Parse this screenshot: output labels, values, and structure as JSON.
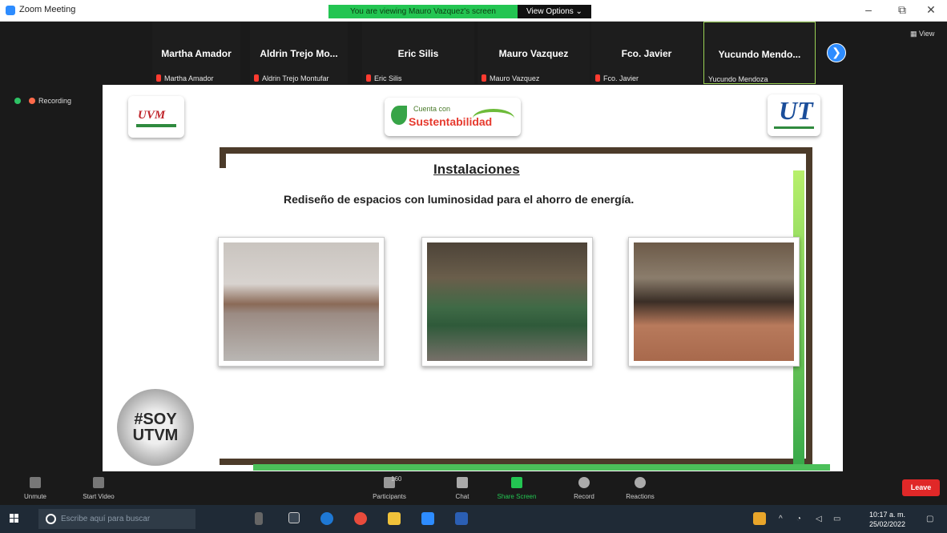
{
  "window": {
    "title": "Zoom Meeting",
    "share_banner": "You are viewing Mauro Vazquez's screen",
    "view_options": "View Options ⌄",
    "minimize": "–",
    "restore": "⧉",
    "close": "✕"
  },
  "gallery": {
    "participants": [
      {
        "name": "Martha Amador",
        "label": "Martha Amador"
      },
      {
        "name": "Aldrin Trejo Mo...",
        "label": "Aldrin Trejo Montufar"
      },
      {
        "name": "Eric Silis",
        "label": "Eric Silis"
      },
      {
        "name": "Mauro Vazquez",
        "label": "Mauro Vazquez"
      },
      {
        "name": "Fco. Javier",
        "label": "Fco. Javier"
      },
      {
        "name": "Yucundo Mendo...",
        "label": "Yucundo Mendoza"
      }
    ],
    "view_button": "View"
  },
  "recording": {
    "label": "Recording"
  },
  "slide": {
    "logo_left": "UVM",
    "logo_center_top": "Cuenta con",
    "logo_center_main": "Sustentabilidad",
    "logo_right": "UT",
    "heading": "Instalaciones",
    "subheading": "Rediseño de espacios con luminosidad para el ahorro de energía.",
    "badge_text": "#SOY UTVM"
  },
  "controls": {
    "unmute": "Unmute",
    "start_video": "Start Video",
    "participants": "Participants",
    "participants_count": "160",
    "chat": "Chat",
    "share_screen": "Share Screen",
    "record": "Record",
    "reactions": "Reactions",
    "leave": "Leave"
  },
  "taskbar": {
    "search_placeholder": "Escribe aquí para buscar",
    "time": "10:17 a. m.",
    "date": "25/02/2022"
  },
  "colors": {
    "banner_green": "#23c552",
    "leave_red": "#e02828",
    "zoom_blue": "#2d8cff",
    "frame_brown": "#4c3b2a"
  }
}
